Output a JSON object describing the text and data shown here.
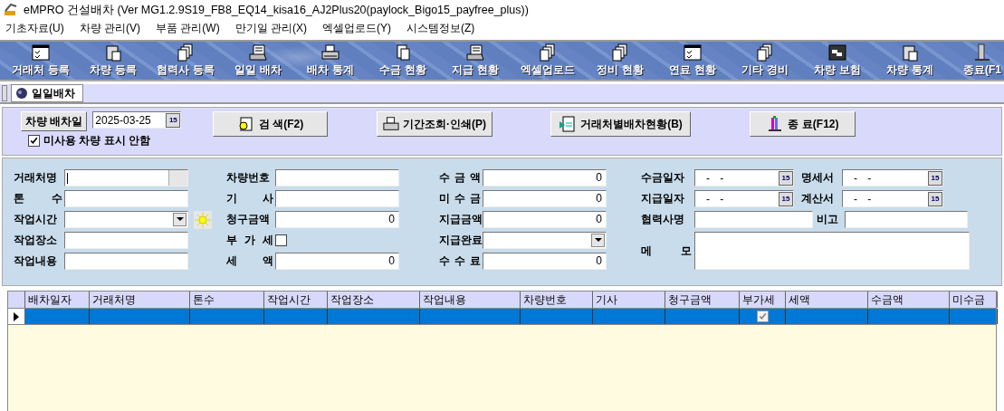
{
  "window": {
    "title": "eMPRO 건설배차 (Ver MG1.2.9S19_FB8_EQ14_kisa16_AJ2Plus20(paylock_Bigo15_payfree_plus))"
  },
  "menu": [
    "기초자료(U)",
    "차량 관리(V)",
    "부품 관리(W)",
    "만기일 관리(X)",
    "엑셀업로드(Y)",
    "시스템정보(Z)"
  ],
  "toolbar": [
    {
      "label": "거래처 등록"
    },
    {
      "label": "차량 등록"
    },
    {
      "label": "협력사 등록"
    },
    {
      "label": "일일 배차"
    },
    {
      "label": "배차 통계"
    },
    {
      "label": "수금 현황"
    },
    {
      "label": "지급 현황"
    },
    {
      "label": "엑셀업로드"
    },
    {
      "label": "정비 현황"
    },
    {
      "label": "연료 현황"
    },
    {
      "label": "기타 경비"
    },
    {
      "label": "차량 보험"
    },
    {
      "label": "차량 통계"
    },
    {
      "label": "종료(F1"
    }
  ],
  "tabs": [
    {
      "label": "일일배차",
      "selected": true
    }
  ],
  "top": {
    "date_button": "차량 배차일",
    "date": "2025-03-25",
    "calendar": "15",
    "hide_unused": {
      "label": "미사용 차량 표시 안함",
      "checked": true
    },
    "buttons": [
      {
        "label": "검 색(F2)"
      },
      {
        "label": "기간조회·인쇄(P)"
      },
      {
        "label": "거래처별배차현황(B)"
      },
      {
        "label": "종 료(F12)"
      }
    ]
  },
  "form": {
    "columns": [
      [
        {
          "label": "거래처명",
          "kind": "lookup"
        },
        {
          "label": "톤 수",
          "kind": "text"
        },
        {
          "label": "작업시간",
          "kind": "combo-sun"
        },
        {
          "label": "작업장소",
          "kind": "text"
        },
        {
          "label": "작업내용",
          "kind": "text"
        }
      ],
      [
        {
          "label": "차량번호",
          "kind": "text"
        },
        {
          "label": "기 사",
          "kind": "text"
        },
        {
          "label": "청구금액",
          "kind": "number",
          "value": "0"
        },
        {
          "label": "부 가 세",
          "kind": "check",
          "checked": false
        },
        {
          "label": "세 액",
          "kind": "number",
          "value": "0"
        }
      ],
      [
        {
          "label": "수 금 액",
          "kind": "number",
          "value": "0"
        },
        {
          "label": "미 수 금",
          "kind": "number",
          "value": "0"
        },
        {
          "label": "지급금액",
          "kind": "number",
          "value": "0"
        },
        {
          "label": "지급완료",
          "kind": "combo"
        },
        {
          "label": "수 수 료",
          "kind": "number",
          "value": "0"
        }
      ]
    ],
    "right_rows": [
      [
        {
          "label": "수금일자",
          "kind": "date",
          "value": "- -",
          "calendar": "15"
        },
        {
          "label": "명세서",
          "kind": "date",
          "value": "- -",
          "calendar": "15"
        }
      ],
      [
        {
          "label": "지급일자",
          "kind": "date",
          "value": "- -",
          "calendar": "15"
        },
        {
          "label": "계산서",
          "kind": "date",
          "value": "- -",
          "calendar": "15"
        }
      ],
      [
        {
          "label": "협력사명",
          "kind": "text"
        },
        {
          "label": "비고",
          "kind": "text"
        }
      ],
      [
        {
          "label": "메 모",
          "kind": "memo"
        }
      ]
    ]
  },
  "grid": {
    "columns": [
      "배차일자",
      "거래처명",
      "톤수",
      "작업시간",
      "작업장소",
      "작업내용",
      "차량번호",
      "기사",
      "청구금액",
      "부가세",
      "세액",
      "수금액",
      "미수금"
    ],
    "rows": [
      {
        "selected": true,
        "vat": true
      }
    ]
  }
}
